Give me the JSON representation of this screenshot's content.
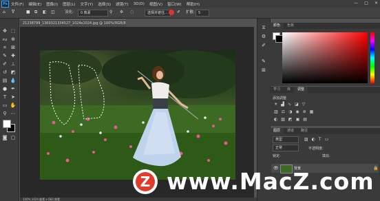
{
  "app": {
    "logo": "Ps"
  },
  "menu": [
    "文件(F)",
    "编辑(E)",
    "图像(I)",
    "图层(L)",
    "文字(Y)",
    "选择(S)",
    "滤镜(T)",
    "3D(D)",
    "视图(V)",
    "窗口(W)",
    "帮助(H)"
  ],
  "window_controls": [
    "—",
    "□",
    "✕"
  ],
  "options": {
    "feather_label": "羽化:",
    "feather_value": "0 像素",
    "style_label": "样式:",
    "style_value": "正常",
    "width_label": "宽度:",
    "height_label": "高度:",
    "refine_button": "选择并遮住...",
    "mode_label": "扩散:",
    "mode_value": "5"
  },
  "document": {
    "tab_title": "21238799_1369321334527_1024x1024.jpg @ 100%(RGB/8) *  ✕",
    "status": "100%   1024 像素 x 683 像素"
  },
  "panels": {
    "color_tabs": [
      "颜色",
      "色板"
    ],
    "adjust_tabs": [
      "学习",
      "库",
      "调整"
    ],
    "adjust_title": "添加调整",
    "layers_tabs": [
      "图层",
      "通道",
      "路径"
    ],
    "kind_label": "类型",
    "blend_mode": "正常",
    "opacity_label": "不透明度:",
    "lock_label": "锁定:",
    "fill_label": "填充:",
    "layer_name": "背景"
  },
  "watermark": {
    "text": "www.MacZ.com",
    "logo_letter": "Z"
  },
  "colors": {
    "accent": "#31a8ff",
    "watermark_logo": "#e23b2b"
  }
}
